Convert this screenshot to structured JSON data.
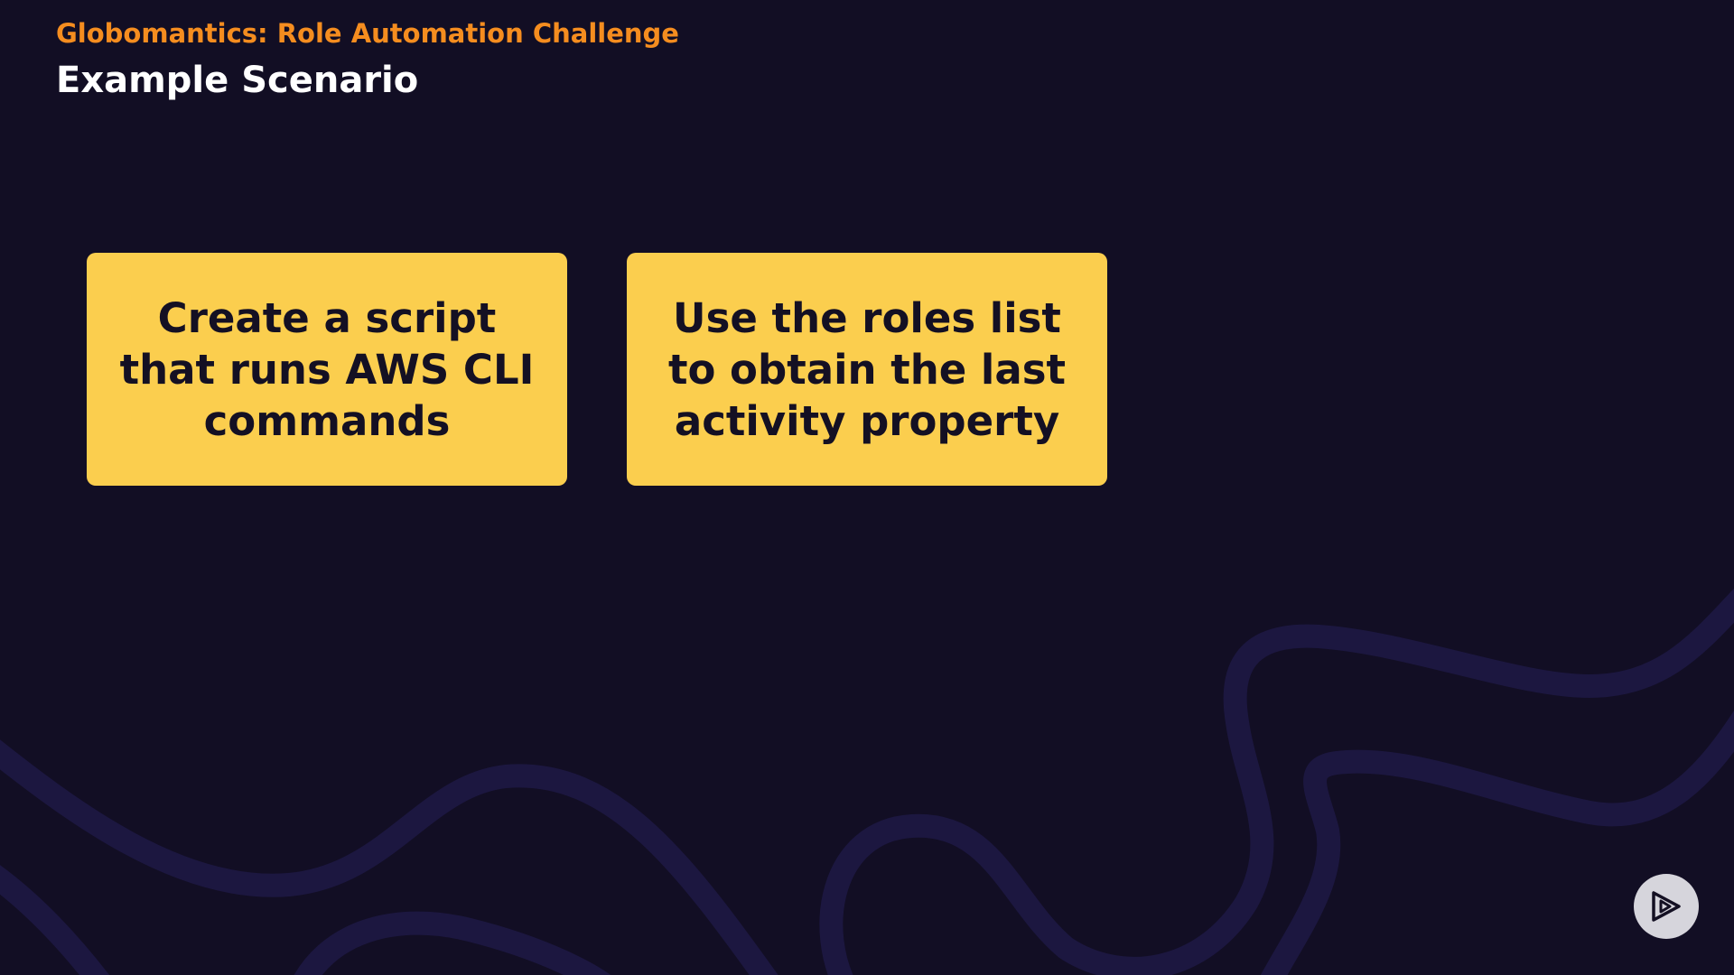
{
  "slide": {
    "subtitle": "Globomantics: Role Automation Challenge",
    "title": "Example Scenario"
  },
  "cards": [
    {
      "text": "Create a script that runs AWS CLI commands"
    },
    {
      "text": "Use the roles list to obtain the last activity property"
    }
  ],
  "colors": {
    "background": "#120e24",
    "accent_orange": "#f58d1f",
    "card_yellow": "#fbce4e",
    "wave": "#1e1842"
  },
  "icons": {
    "brand": "play-logo-icon"
  }
}
